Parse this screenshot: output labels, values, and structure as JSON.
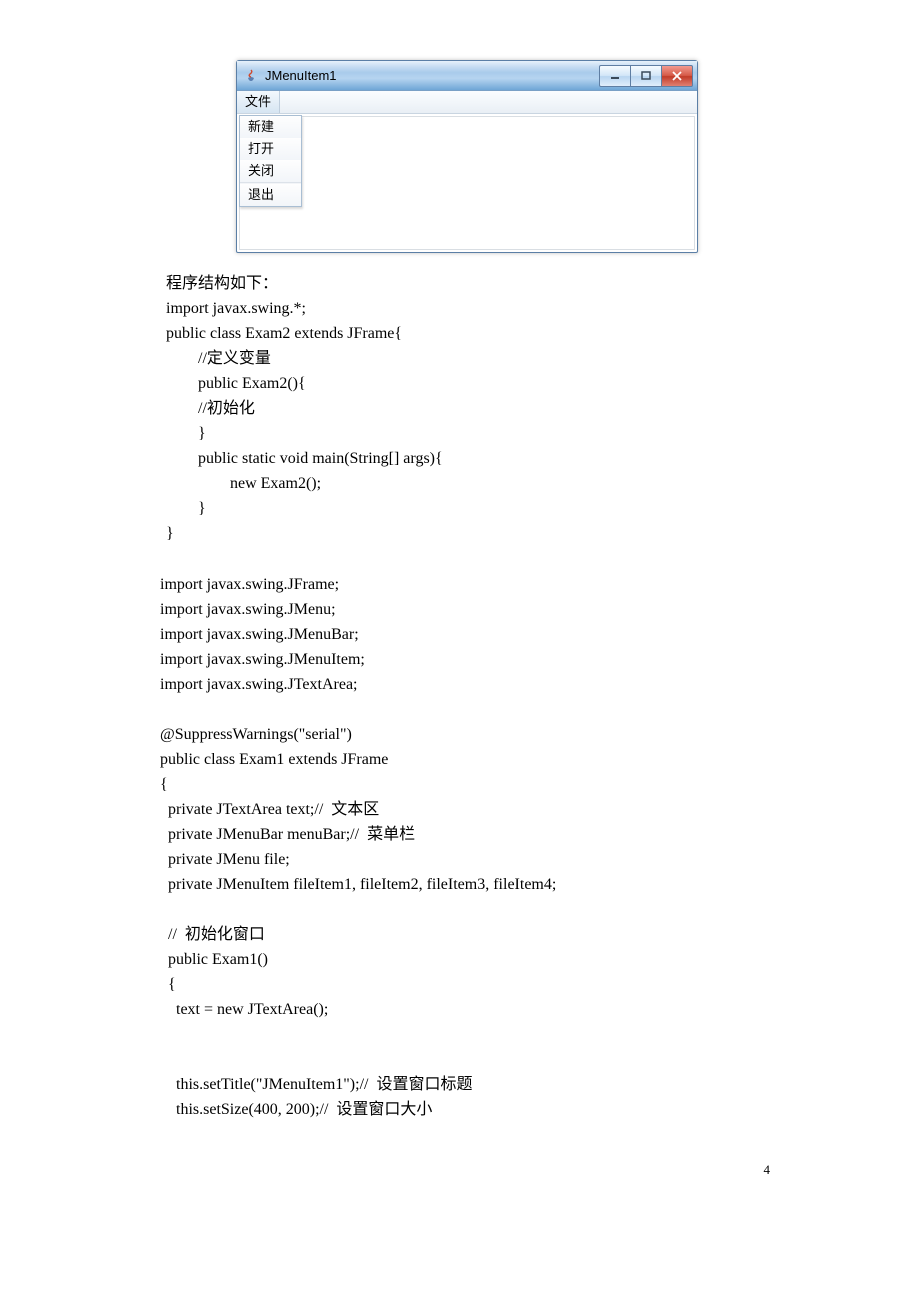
{
  "window": {
    "title": "JMenuItem1",
    "menu": {
      "file": "文件"
    },
    "dropdown": [
      "新建",
      "打开",
      "关闭",
      "退出"
    ]
  },
  "desc": {
    "l1": "程序结构如下：",
    "l2": "import javax.swing.*;",
    "l3": "public class Exam2 extends JFrame{",
    "l4": "//定义变量",
    "l5": "public Exam2(){",
    "l6": "//初始化",
    "l7": "}",
    "l8": "public static void main(String[] args){",
    "l9": "new Exam2();",
    "l10": "}",
    "l11": "}"
  },
  "code": "import javax.swing.JFrame;\nimport javax.swing.JMenu;\nimport javax.swing.JMenuBar;\nimport javax.swing.JMenuItem;\nimport javax.swing.JTextArea;\n\n@SuppressWarnings(\"serial\")\npublic class Exam1 extends JFrame\n{\n  private JTextArea text;//  文本区\n  private JMenuBar menuBar;//  菜单栏\n  private JMenu file;\n  private JMenuItem fileItem1, fileItem2, fileItem3, fileItem4;\n\n  //  初始化窗口\n  public Exam1()\n  {\n    text = new JTextArea();\n\n\n    this.setTitle(\"JMenuItem1\");//  设置窗口标题\n    this.setSize(400, 200);//  设置窗口大小",
  "pagenum": "4"
}
